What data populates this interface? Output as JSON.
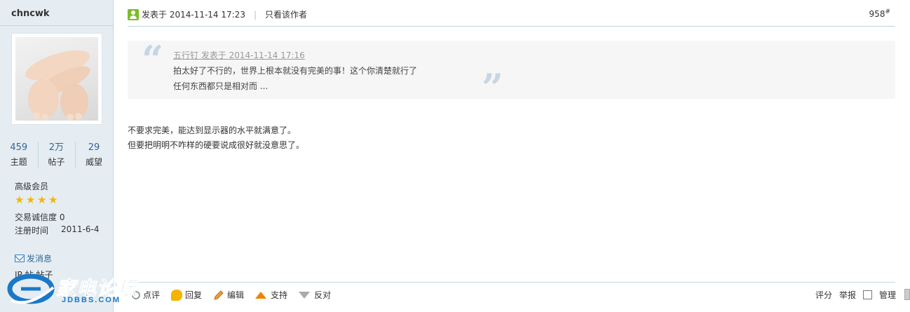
{
  "author": {
    "name": "chncwk",
    "stats": [
      {
        "value": "459",
        "label": "主题"
      },
      {
        "value": "2万",
        "label": "帖子"
      },
      {
        "value": "29",
        "label": "威望"
      }
    ],
    "rank": "高级会员",
    "stars": 4,
    "credit": "交易诚信度 0",
    "reg_label": "注册时间",
    "reg_date": "2011-6-4",
    "send_pm": "发消息",
    "ip_line": "IP 帖 帖子"
  },
  "post": {
    "posted_at": "发表于 2014-11-14 17:23",
    "only_author": "只看该作者",
    "floor": "958",
    "floor_mark": "#",
    "quote": {
      "meta": "五行钉 发表于 2014-11-14 17:16",
      "line1": "拍太好了不行的，世界上根本就没有完美的事！这个你清楚就行了",
      "line2": "任何东西都只是相对而 ..."
    },
    "body": [
      "不要求完美，能达到显示器的水平就满意了。",
      "但要把明明不咋样的硬要说成很好就没意思了。"
    ]
  },
  "actions": {
    "comment": "点评",
    "reply": "回复",
    "edit": "编辑",
    "support": "支持",
    "oppose": "反对",
    "rate": "评分",
    "report": "举报",
    "manage": "管理"
  },
  "logo": {
    "title": "家电论坛",
    "sub": "JDBBS.COM"
  },
  "colors": {
    "sidebar_bg": "#e5edf2",
    "border": "#c2d5e3",
    "link": "#336699",
    "quote_bg": "#f6f6f6",
    "logo_blue": "#1a78c8"
  }
}
